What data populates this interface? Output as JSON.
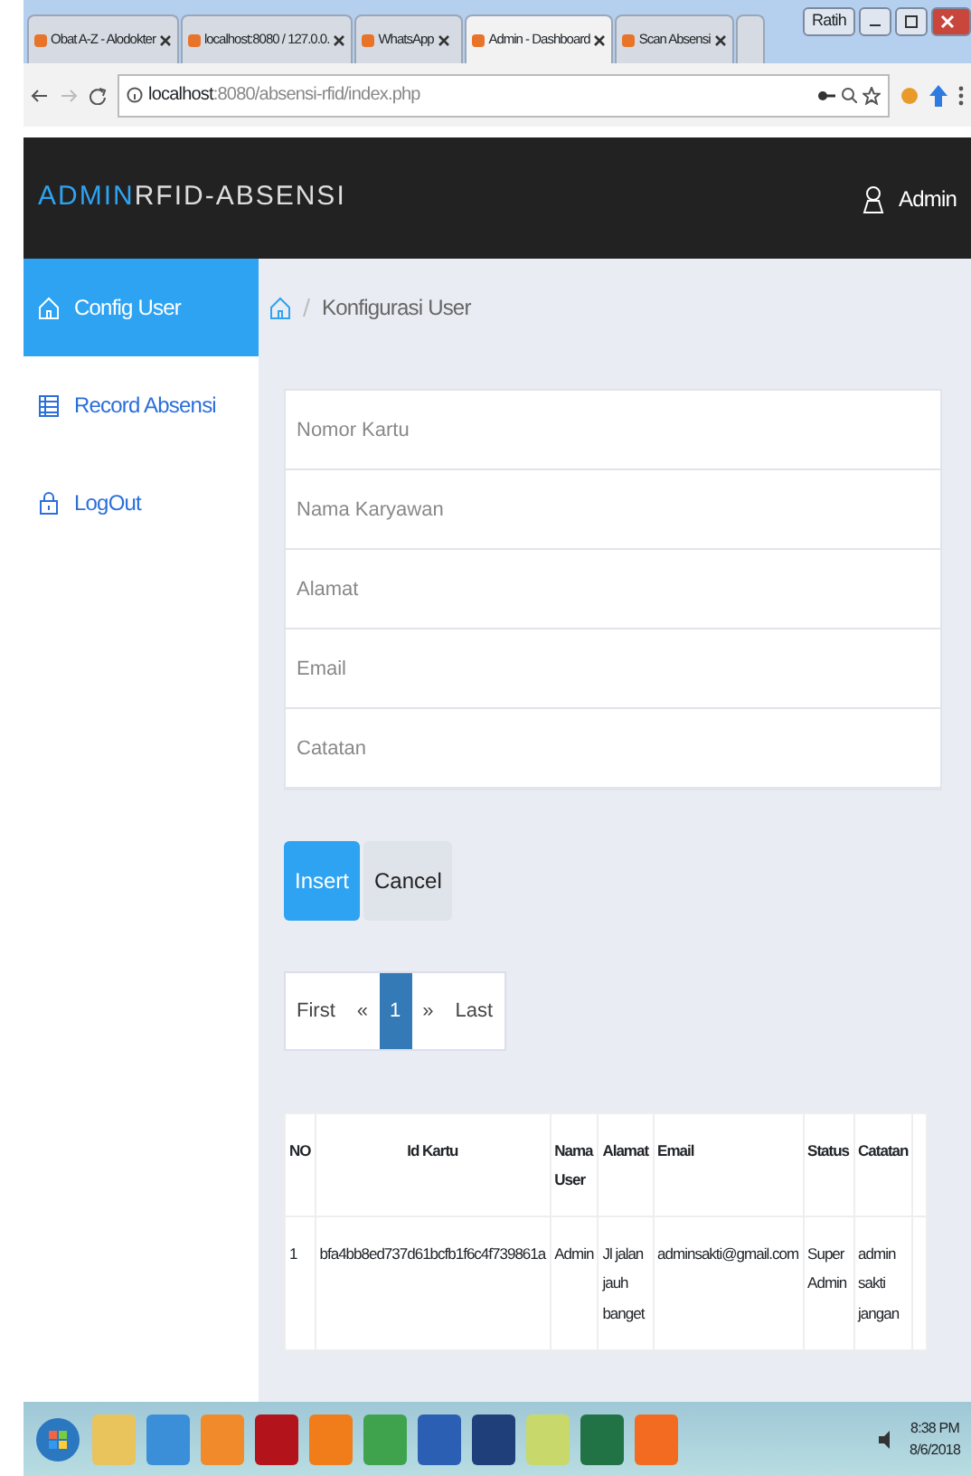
{
  "browser": {
    "tabs": [
      {
        "label": "Obat A-Z - Alodokter",
        "selected": false
      },
      {
        "label": "localhost:8080 / 127.0.0.",
        "selected": false
      },
      {
        "label": "WhatsApp",
        "selected": false
      },
      {
        "label": "Admin - Dashboard",
        "selected": true
      },
      {
        "label": "Scan Absensi",
        "selected": false
      }
    ],
    "window_buttons": {
      "user_label": "Ratih"
    },
    "address": {
      "host": "localhost",
      "path": ":8080/absensi-rfid/index.php"
    }
  },
  "navbar": {
    "brand_accent": "ADMIN",
    "brand_rest": "RFID-ABSENSI",
    "user": "Admin"
  },
  "sidebar": {
    "items": [
      {
        "label": "Config User",
        "selected": true
      },
      {
        "label": "Record Absensi",
        "selected": false
      },
      {
        "label": "LogOut",
        "selected": false
      }
    ]
  },
  "breadcrumb": {
    "label": "Konfigurasi User"
  },
  "form": {
    "fields": [
      {
        "placeholder": "Nomor Kartu"
      },
      {
        "placeholder": "Nama Karyawan"
      },
      {
        "placeholder": "Alamat"
      },
      {
        "placeholder": "Email"
      },
      {
        "placeholder": "Catatan"
      }
    ],
    "buttons": [
      {
        "label": "Insert",
        "kind": "primary"
      },
      {
        "label": "Cancel",
        "kind": "secondary"
      }
    ]
  },
  "pagination": [
    {
      "label": "First",
      "selected": false
    },
    {
      "label": "«",
      "selected": false
    },
    {
      "label": "1",
      "selected": true
    },
    {
      "label": "»",
      "selected": false
    },
    {
      "label": "Last",
      "selected": false
    }
  ],
  "table": {
    "columns": [
      "NO",
      "Id Kartu",
      "Nama User",
      "Alamat",
      "Email",
      "Status",
      "Catatan",
      ""
    ],
    "rows": [
      [
        "1",
        "bfa4bb8ed737d61bcfb1f6c4f739861a",
        "Admin",
        "Jl jalan jauh banget",
        "adminsakti@gmail.com",
        "Super Admin",
        "admin sakti jangan",
        ""
      ]
    ]
  },
  "taskbar": {
    "time": "8:38 PM",
    "date": "8/6/2018"
  }
}
